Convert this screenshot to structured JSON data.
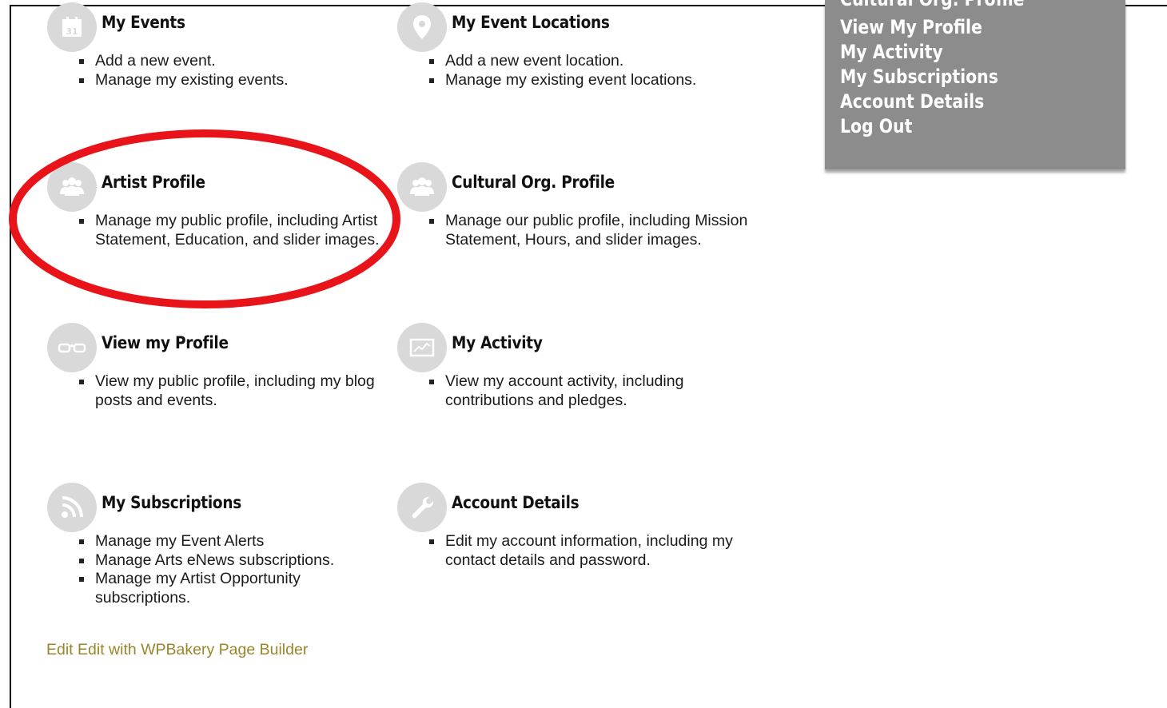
{
  "side_menu": {
    "items": [
      "Cultural Org. Profile",
      "View My Profile",
      "My Activity",
      "My Subscriptions",
      "Account Details",
      "Log Out"
    ]
  },
  "cards": {
    "my_events": {
      "icon": "calendar-icon",
      "calendar_day": "31",
      "title": "My Events",
      "items": [
        "Add a new event.",
        "Manage my existing events."
      ]
    },
    "my_event_locations": {
      "icon": "map-pin-icon",
      "title": "My Event Locations",
      "items": [
        "Add a new event location.",
        "Manage my existing event locations."
      ]
    },
    "artist_profile": {
      "icon": "group-icon",
      "title": "Artist Profile",
      "items": [
        "Manage my public profile, including Artist Statement, Education, and slider images."
      ]
    },
    "cultural_org_profile": {
      "icon": "group-icon",
      "title": "Cultural Org. Profile",
      "items": [
        "Manage our public profile, including Mission Statement, Hours, and slider images."
      ]
    },
    "view_my_profile": {
      "icon": "glasses-icon",
      "title": "View my Profile",
      "items": [
        "View my public profile, including my blog posts and events."
      ]
    },
    "my_activity": {
      "icon": "activity-chart-icon",
      "title": "My Activity",
      "items": [
        "View my account activity, including contributions and pledges."
      ]
    },
    "my_subscriptions": {
      "icon": "rss-icon",
      "title": "My Subscriptions",
      "items": [
        "Manage my Event Alerts",
        "Manage Arts eNews subscriptions.",
        "Manage my Artist Opportunity subscriptions."
      ]
    },
    "account_details": {
      "icon": "wrench-icon",
      "title": "Account Details",
      "items": [
        "Edit my account information, including my contact details and password."
      ]
    }
  },
  "edit_link": "Edit Edit with WPBakery Page Builder",
  "colors": {
    "icon_bg": "#d9d9d9",
    "menu_bg": "#8c8c8c",
    "link": "#9a8528",
    "annotation": "#e8141a"
  }
}
